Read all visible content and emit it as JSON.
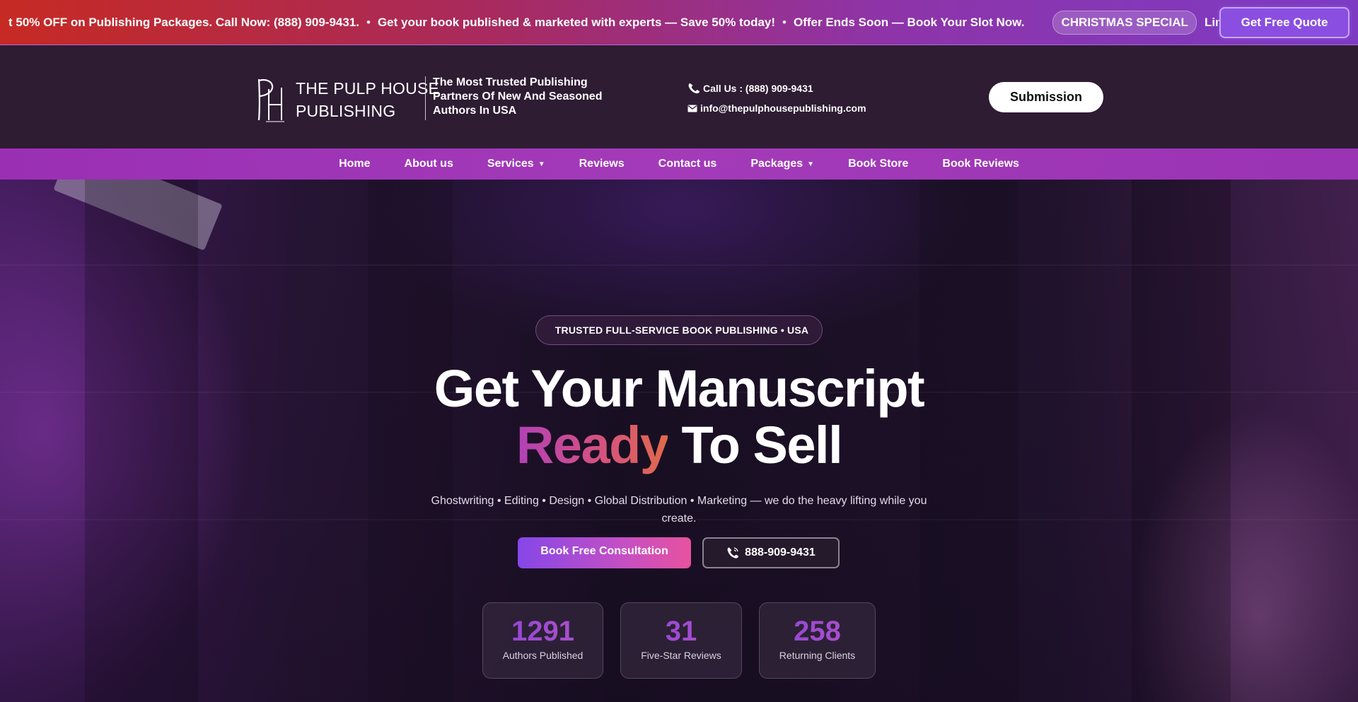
{
  "promo": {
    "messages": [
      "t 50% OFF on Publishing Packages. Call Now: (888) 909-9431.",
      "Get your book published & marketed with experts — Save 50% today!",
      "Offer Ends Soon — Book Your Slot Now."
    ],
    "separator": "•",
    "badge": "CHRISTMAS SPECIAL",
    "trailing": "Limited T",
    "cta": "Get Free Quote"
  },
  "header": {
    "logo_line1": "THE PULP HOUSE",
    "logo_line2": "PUBLISHING",
    "tagline": "The Most Trusted Publishing Partners Of New And Seasoned Authors In USA",
    "phone": "Call Us : (888) 909-9431",
    "email": "info@thepulphousepublishing.com",
    "submit": "Submission"
  },
  "nav": {
    "items": [
      {
        "label": "Home"
      },
      {
        "label": "About us"
      },
      {
        "label": "Services",
        "dropdown": true
      },
      {
        "label": "Reviews"
      },
      {
        "label": "Contact us"
      },
      {
        "label": "Packages",
        "dropdown": true
      },
      {
        "label": "Book Store"
      },
      {
        "label": "Book Reviews"
      }
    ]
  },
  "hero": {
    "badge_icon": "",
    "badge": "TRUSTED FULL-SERVICE BOOK PUBLISHING • USA",
    "title_line1": "Get Your Manuscript",
    "title_accent": "Ready",
    "title_rest": "To Sell",
    "subtitle": "Ghostwriting • Editing • Design • Global Distribution • Marketing — we do the heavy lifting while you create.",
    "cta_primary": "Book Free Consultation",
    "cta_phone": "888-909-9431",
    "stats": [
      {
        "value": "1291",
        "label": "Authors Published"
      },
      {
        "value": "31",
        "label": "Five-Star Reviews"
      },
      {
        "value": "258",
        "label": "Returning Clients"
      }
    ]
  },
  "colors": {
    "accent_purple": "#9a2fb4",
    "header_bg": "#2e1c33",
    "gradient_start": "#8547e8",
    "gradient_end": "#e752a0"
  },
  "icons": {
    "phone": "phone-icon",
    "email": "envelope-icon",
    "dropdown": "caret-down-icon"
  }
}
